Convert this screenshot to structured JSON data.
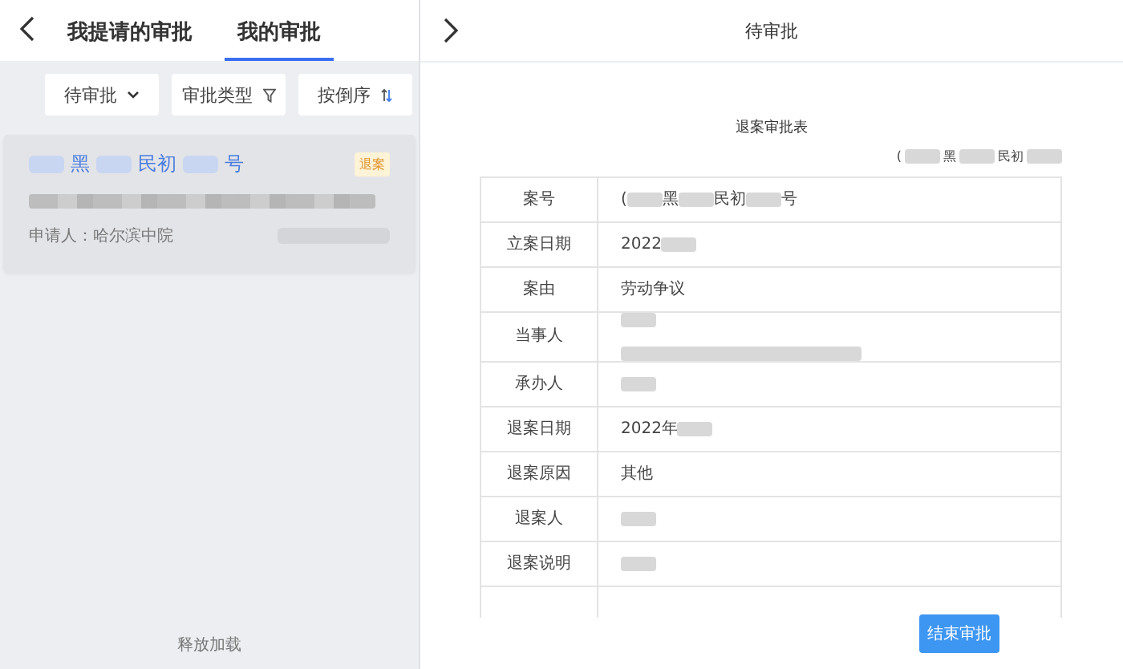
{
  "left_panel": {
    "tabs": [
      {
        "label": "我提请的审批",
        "selected": false
      },
      {
        "label": "我的审批",
        "selected": true
      }
    ],
    "filters": [
      {
        "label": "待审批"
      },
      {
        "label": "审批类型"
      },
      {
        "label": "按倒序"
      }
    ],
    "card": {
      "case_number": [
        {
          "kind": "blur"
        },
        {
          "kind": "text",
          "text": "黑"
        },
        {
          "kind": "blur"
        },
        {
          "kind": "text",
          "text": "民初"
        },
        {
          "kind": "blur"
        },
        {
          "kind": "text",
          "text": "号"
        }
      ],
      "tag": "退案",
      "applicant": "申请人：哈尔滨中院"
    },
    "footer": "释放加载"
  },
  "right_panel": {
    "title": "待审批",
    "form_title": "退案审批表",
    "form_number": [
      {
        "kind": "text",
        "text": "("
      },
      {
        "kind": "blur"
      },
      {
        "kind": "text",
        "text": "黑"
      },
      {
        "kind": "blur"
      },
      {
        "kind": "text",
        "text": "民初"
      },
      {
        "kind": "blur"
      }
    ],
    "rows": [
      {
        "label": "案号",
        "value": [
          {
            "kind": "text",
            "text": "("
          },
          {
            "kind": "blur"
          },
          {
            "kind": "text",
            "text": "黑"
          },
          {
            "kind": "blur"
          },
          {
            "kind": "text",
            "text": "民初"
          },
          {
            "kind": "blur"
          },
          {
            "kind": "text",
            "text": "号"
          }
        ]
      },
      {
        "label": "立案日期",
        "value": [
          {
            "kind": "text",
            "text": "2022"
          },
          {
            "kind": "blur"
          }
        ]
      },
      {
        "label": "案由",
        "value": [
          {
            "kind": "text",
            "text": "劳动争议"
          }
        ]
      },
      {
        "label": "当事人",
        "value": [
          {
            "kind": "blur"
          },
          {
            "kind": "break"
          },
          {
            "kind": "blur-line"
          }
        ]
      },
      {
        "label": "承办人",
        "value": [
          {
            "kind": "blur"
          }
        ]
      },
      {
        "label": "退案日期",
        "value": [
          {
            "kind": "text",
            "text": "2022年"
          },
          {
            "kind": "blur"
          }
        ]
      },
      {
        "label": "退案原因",
        "value": [
          {
            "kind": "text",
            "text": "其他"
          }
        ]
      },
      {
        "label": "退案人",
        "value": [
          {
            "kind": "blur"
          }
        ]
      },
      {
        "label": "退案说明",
        "value": [
          {
            "kind": "blur"
          }
        ]
      }
    ],
    "button": "结束审批"
  }
}
